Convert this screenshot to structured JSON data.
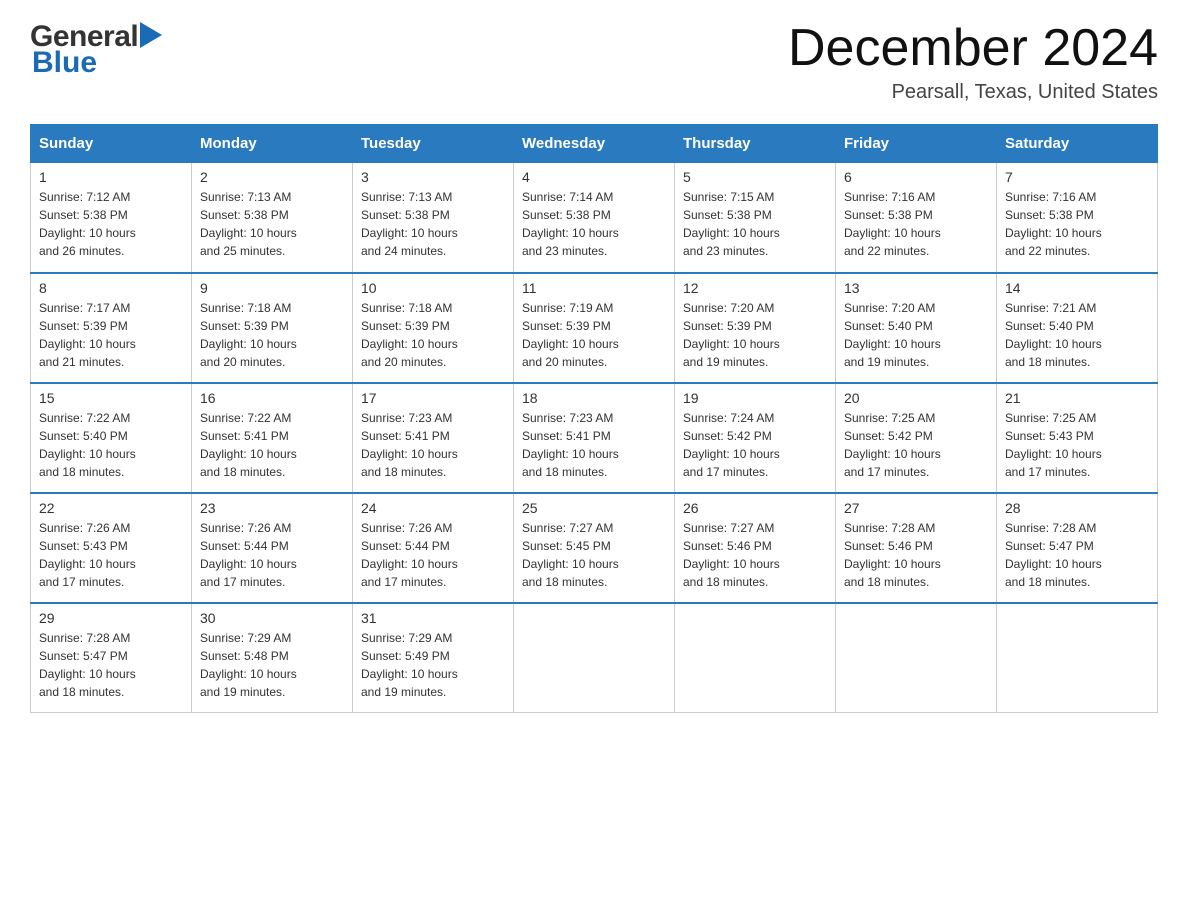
{
  "header": {
    "logo_general": "General",
    "logo_blue": "Blue",
    "month": "December 2024",
    "location": "Pearsall, Texas, United States"
  },
  "weekdays": [
    "Sunday",
    "Monday",
    "Tuesday",
    "Wednesday",
    "Thursday",
    "Friday",
    "Saturday"
  ],
  "weeks": [
    [
      {
        "day": "1",
        "info": "Sunrise: 7:12 AM\nSunset: 5:38 PM\nDaylight: 10 hours\nand 26 minutes."
      },
      {
        "day": "2",
        "info": "Sunrise: 7:13 AM\nSunset: 5:38 PM\nDaylight: 10 hours\nand 25 minutes."
      },
      {
        "day": "3",
        "info": "Sunrise: 7:13 AM\nSunset: 5:38 PM\nDaylight: 10 hours\nand 24 minutes."
      },
      {
        "day": "4",
        "info": "Sunrise: 7:14 AM\nSunset: 5:38 PM\nDaylight: 10 hours\nand 23 minutes."
      },
      {
        "day": "5",
        "info": "Sunrise: 7:15 AM\nSunset: 5:38 PM\nDaylight: 10 hours\nand 23 minutes."
      },
      {
        "day": "6",
        "info": "Sunrise: 7:16 AM\nSunset: 5:38 PM\nDaylight: 10 hours\nand 22 minutes."
      },
      {
        "day": "7",
        "info": "Sunrise: 7:16 AM\nSunset: 5:38 PM\nDaylight: 10 hours\nand 22 minutes."
      }
    ],
    [
      {
        "day": "8",
        "info": "Sunrise: 7:17 AM\nSunset: 5:39 PM\nDaylight: 10 hours\nand 21 minutes."
      },
      {
        "day": "9",
        "info": "Sunrise: 7:18 AM\nSunset: 5:39 PM\nDaylight: 10 hours\nand 20 minutes."
      },
      {
        "day": "10",
        "info": "Sunrise: 7:18 AM\nSunset: 5:39 PM\nDaylight: 10 hours\nand 20 minutes."
      },
      {
        "day": "11",
        "info": "Sunrise: 7:19 AM\nSunset: 5:39 PM\nDaylight: 10 hours\nand 20 minutes."
      },
      {
        "day": "12",
        "info": "Sunrise: 7:20 AM\nSunset: 5:39 PM\nDaylight: 10 hours\nand 19 minutes."
      },
      {
        "day": "13",
        "info": "Sunrise: 7:20 AM\nSunset: 5:40 PM\nDaylight: 10 hours\nand 19 minutes."
      },
      {
        "day": "14",
        "info": "Sunrise: 7:21 AM\nSunset: 5:40 PM\nDaylight: 10 hours\nand 18 minutes."
      }
    ],
    [
      {
        "day": "15",
        "info": "Sunrise: 7:22 AM\nSunset: 5:40 PM\nDaylight: 10 hours\nand 18 minutes."
      },
      {
        "day": "16",
        "info": "Sunrise: 7:22 AM\nSunset: 5:41 PM\nDaylight: 10 hours\nand 18 minutes."
      },
      {
        "day": "17",
        "info": "Sunrise: 7:23 AM\nSunset: 5:41 PM\nDaylight: 10 hours\nand 18 minutes."
      },
      {
        "day": "18",
        "info": "Sunrise: 7:23 AM\nSunset: 5:41 PM\nDaylight: 10 hours\nand 18 minutes."
      },
      {
        "day": "19",
        "info": "Sunrise: 7:24 AM\nSunset: 5:42 PM\nDaylight: 10 hours\nand 17 minutes."
      },
      {
        "day": "20",
        "info": "Sunrise: 7:25 AM\nSunset: 5:42 PM\nDaylight: 10 hours\nand 17 minutes."
      },
      {
        "day": "21",
        "info": "Sunrise: 7:25 AM\nSunset: 5:43 PM\nDaylight: 10 hours\nand 17 minutes."
      }
    ],
    [
      {
        "day": "22",
        "info": "Sunrise: 7:26 AM\nSunset: 5:43 PM\nDaylight: 10 hours\nand 17 minutes."
      },
      {
        "day": "23",
        "info": "Sunrise: 7:26 AM\nSunset: 5:44 PM\nDaylight: 10 hours\nand 17 minutes."
      },
      {
        "day": "24",
        "info": "Sunrise: 7:26 AM\nSunset: 5:44 PM\nDaylight: 10 hours\nand 17 minutes."
      },
      {
        "day": "25",
        "info": "Sunrise: 7:27 AM\nSunset: 5:45 PM\nDaylight: 10 hours\nand 18 minutes."
      },
      {
        "day": "26",
        "info": "Sunrise: 7:27 AM\nSunset: 5:46 PM\nDaylight: 10 hours\nand 18 minutes."
      },
      {
        "day": "27",
        "info": "Sunrise: 7:28 AM\nSunset: 5:46 PM\nDaylight: 10 hours\nand 18 minutes."
      },
      {
        "day": "28",
        "info": "Sunrise: 7:28 AM\nSunset: 5:47 PM\nDaylight: 10 hours\nand 18 minutes."
      }
    ],
    [
      {
        "day": "29",
        "info": "Sunrise: 7:28 AM\nSunset: 5:47 PM\nDaylight: 10 hours\nand 18 minutes."
      },
      {
        "day": "30",
        "info": "Sunrise: 7:29 AM\nSunset: 5:48 PM\nDaylight: 10 hours\nand 19 minutes."
      },
      {
        "day": "31",
        "info": "Sunrise: 7:29 AM\nSunset: 5:49 PM\nDaylight: 10 hours\nand 19 minutes."
      },
      {
        "day": "",
        "info": ""
      },
      {
        "day": "",
        "info": ""
      },
      {
        "day": "",
        "info": ""
      },
      {
        "day": "",
        "info": ""
      }
    ]
  ]
}
